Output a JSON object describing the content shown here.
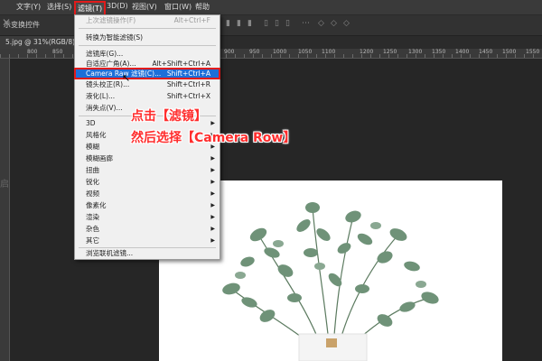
{
  "menubar": {
    "items": [
      {
        "label": "文字(Y)"
      },
      {
        "label": "选择(S)"
      },
      {
        "label": "滤镜(T)"
      },
      {
        "label": "3D(D)"
      },
      {
        "label": "视图(V)"
      },
      {
        "label": "窗口(W)"
      },
      {
        "label": "帮助"
      }
    ]
  },
  "options": {
    "label": "示变换控件"
  },
  "document": {
    "tab": "5.jpg @ 31%(RGB/8)"
  },
  "ruler": {
    "labels": [
      "800",
      "850",
      "900",
      "950",
      "1000",
      "1050",
      "1100",
      "1200",
      "1250",
      "1300",
      "1350",
      "1400",
      "1450",
      "1500",
      "1550"
    ]
  },
  "filter_menu": {
    "items": [
      {
        "label": "上次滤镜操作(F)",
        "shortcut": "Alt+Ctrl+F",
        "disabled": true
      },
      {
        "label": "转换为智能滤镜(S)",
        "shortcut": ""
      },
      {
        "label": "滤镜库(G)...",
        "shortcut": ""
      },
      {
        "label": "自适应广角(A)...",
        "shortcut": "Alt+Shift+Ctrl+A"
      },
      {
        "label": "Camera Raw 滤镜(C)...",
        "shortcut": "Shift+Ctrl+A"
      },
      {
        "label": "镜头校正(R)...",
        "shortcut": "Shift+Ctrl+R"
      },
      {
        "label": "液化(L)...",
        "shortcut": "Shift+Ctrl+X"
      },
      {
        "label": "消失点(V)...",
        "shortcut": ""
      },
      {
        "label": "3D",
        "shortcut": ""
      },
      {
        "label": "风格化",
        "shortcut": ""
      },
      {
        "label": "模糊",
        "shortcut": ""
      },
      {
        "label": "模糊画廊",
        "shortcut": ""
      },
      {
        "label": "扭曲",
        "shortcut": ""
      },
      {
        "label": "锐化",
        "shortcut": ""
      },
      {
        "label": "视频",
        "shortcut": ""
      },
      {
        "label": "像素化",
        "shortcut": ""
      },
      {
        "label": "渲染",
        "shortcut": ""
      },
      {
        "label": "杂色",
        "shortcut": ""
      },
      {
        "label": "其它",
        "shortcut": ""
      },
      {
        "label": "浏览联机滤镜...",
        "shortcut": ""
      }
    ]
  },
  "annotation": {
    "line1": "点击【滤镜】",
    "line2": "然后选择【Camera Row】"
  },
  "side": {
    "text": "启"
  },
  "colors": {
    "accent": "#1e6fd8",
    "annotation": "#ff2d2d",
    "highlight_border": "#e21b1b"
  }
}
